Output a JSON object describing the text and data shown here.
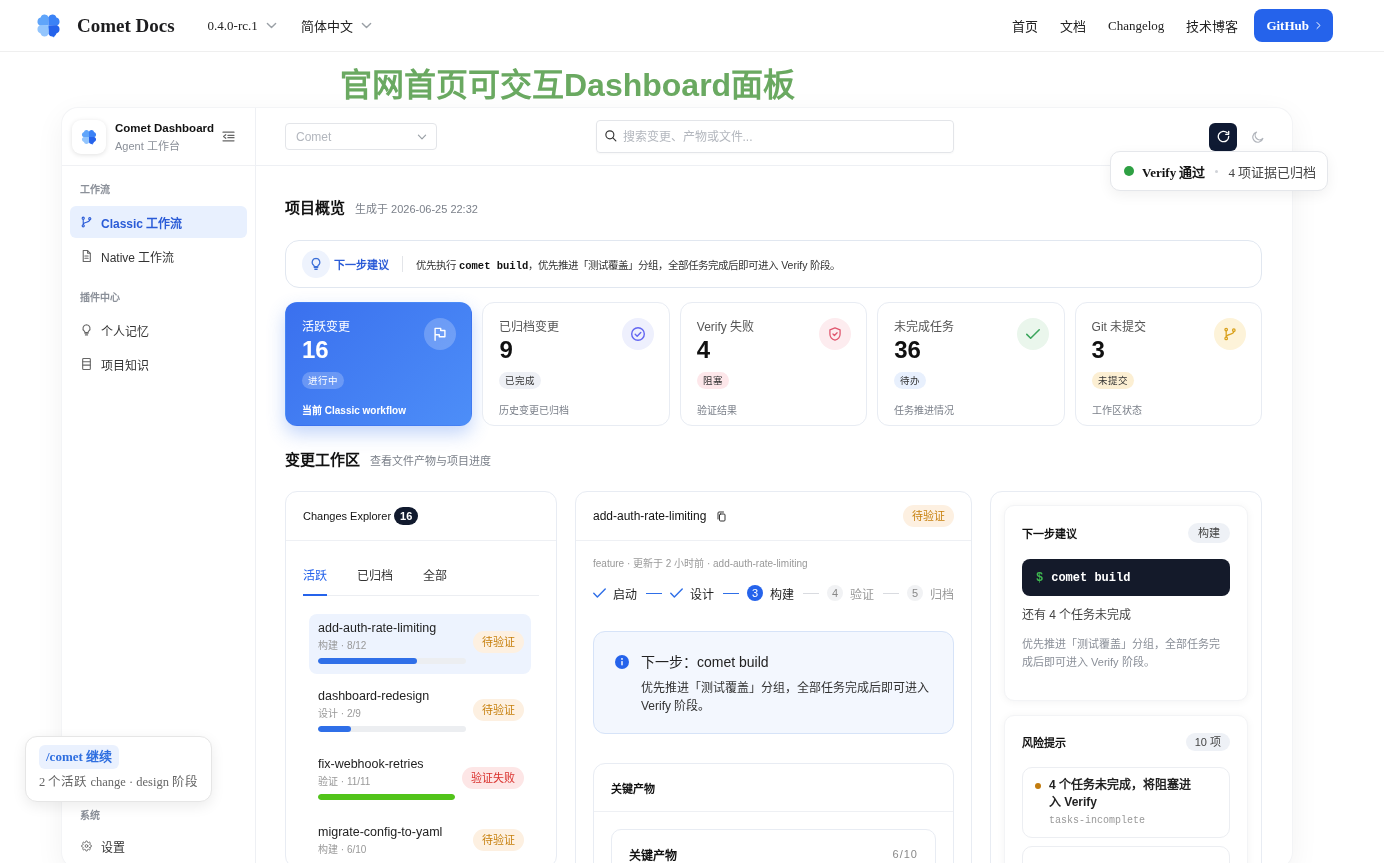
{
  "top_nav": {
    "brand": "Comet Docs",
    "version": "0.4.0-rc.1",
    "language": "简体中文",
    "links": [
      "首页",
      "文档",
      "Changelog",
      "技术博客"
    ],
    "button": "GitHub"
  },
  "banner": {
    "title": "官网首页可交互Dashboard面板"
  },
  "sidebar": {
    "title": "Comet Dashboard",
    "subtitle": "Agent 工作台",
    "sections": [
      {
        "label": "工作流",
        "items": [
          {
            "label": "Classic 工作流",
            "selected": true
          },
          {
            "label": "Native 工作流",
            "selected": false
          }
        ]
      },
      {
        "label": "插件中心",
        "items": [
          {
            "label": "个人记忆",
            "selected": false
          },
          {
            "label": "项目知识",
            "selected": false
          }
        ]
      },
      {
        "label": "系统",
        "items": [
          {
            "label": "设置",
            "selected": false
          }
        ]
      }
    ]
  },
  "header": {
    "project_select": {
      "placeholder": "Comet"
    },
    "search": {
      "placeholder": "搜索变更、产物或文件..."
    }
  },
  "verify_popover": {
    "passed": true,
    "title": "Verify 通过",
    "detail": "4 项证据已归档"
  },
  "overview": {
    "title": "项目概览",
    "generated": "生成于 2026-06-25 22:32",
    "suggestion": {
      "label": "下一步建议",
      "text": "优先执行 **comet build**，优先推进「测试覆盖」分组，全部任务完成后即可进入 Verify 阶段。"
    },
    "stats": [
      {
        "label": "活跃变更",
        "value": "16",
        "badge": "进行中",
        "caption": "当前 Classic workflow",
        "selected": true
      },
      {
        "kind": "archived",
        "label": "已归档变更",
        "value": "9",
        "badge": "已完成",
        "caption": "历史变更已归档",
        "selected": false
      },
      {
        "kind": "failed",
        "label": "Verify 失败",
        "value": "4",
        "badge": "阻塞",
        "caption": "验证结果",
        "selected": false
      },
      {
        "kind": "todo",
        "label": "未完成任务",
        "value": "36",
        "badge": "待办",
        "caption": "任务推进情况",
        "selected": false
      },
      {
        "kind": "uncommitted",
        "label": "Git 未提交",
        "value": "3",
        "badge": "未提交",
        "caption": "工作区状态",
        "selected": false
      }
    ]
  },
  "workspace": {
    "title": "变更工作区",
    "subtitle": "查看文件产物与项目进度",
    "explorer": {
      "title": "Changes Explorer",
      "count": "16",
      "tabs": [
        {
          "label": "活跃",
          "selected": true
        },
        {
          "label": "已归档",
          "selected": false
        },
        {
          "label": "全部",
          "selected": false
        }
      ],
      "items": [
        {
          "kind": "pending",
          "name": "add-auth-rate-limiting",
          "meta": "构建 · 8/12",
          "status": "待验证",
          "level": 0.67,
          "selected": true
        },
        {
          "kind": "pending",
          "name": "dashboard-redesign",
          "meta": "设计 · 2/9",
          "status": "待验证",
          "level": 0.22,
          "selected": false
        },
        {
          "kind": "failed",
          "name": "fix-webhook-retries",
          "meta": "验证 · 11/11",
          "status": "验证失败",
          "level": 1,
          "selected": false
        },
        {
          "kind": "pending",
          "name": "migrate-config-to-yaml",
          "meta": "构建 · 6/10",
          "status": "待验证",
          "selected": false
        }
      ]
    },
    "detail": {
      "kind": "pending",
      "name": "add-auth-rate-limiting",
      "status": "待验证",
      "meta": "feature · 更新于 2 小时前 · add-auth-rate-limiting",
      "steps": [
        {
          "kind": "done",
          "label": "启动"
        },
        {
          "kind": "done",
          "label": "设计"
        },
        {
          "kind": "current",
          "number": "3",
          "label": "构建"
        },
        {
          "kind": "todo",
          "number": "4",
          "label": "验证"
        },
        {
          "kind": "todo",
          "number": "5",
          "label": "归档"
        }
      ],
      "next_step": {
        "title": "下一步：comet build",
        "text": "优先推进「测试覆盖」分组，全部任务完成后即可进入 Verify 阶段。"
      },
      "artifacts": {
        "title": "关键产物",
        "group": {
          "title": "关键产物",
          "count": "6/10"
        }
      }
    },
    "side_panel": {
      "next": {
        "title": "下一步建议",
        "badge": "构建",
        "prompt": "$",
        "command": "comet build",
        "summary": "还有 4 个任务未完成",
        "text": "优先推进「测试覆盖」分组，全部任务完成后即可进入 Verify 阶段。"
      },
      "risks": {
        "title": "风险提示",
        "count": "10 项",
        "items": [
          {
            "title": "4 个任务未完成，将阻塞进入 Verify",
            "code": "tasks-incomplete",
            "color": "#c27c0e"
          }
        ],
        "more": true
      }
    }
  },
  "resume_toast": {
    "command": "/comet 继续",
    "detail": "2 个活跃 change · design 阶段"
  }
}
